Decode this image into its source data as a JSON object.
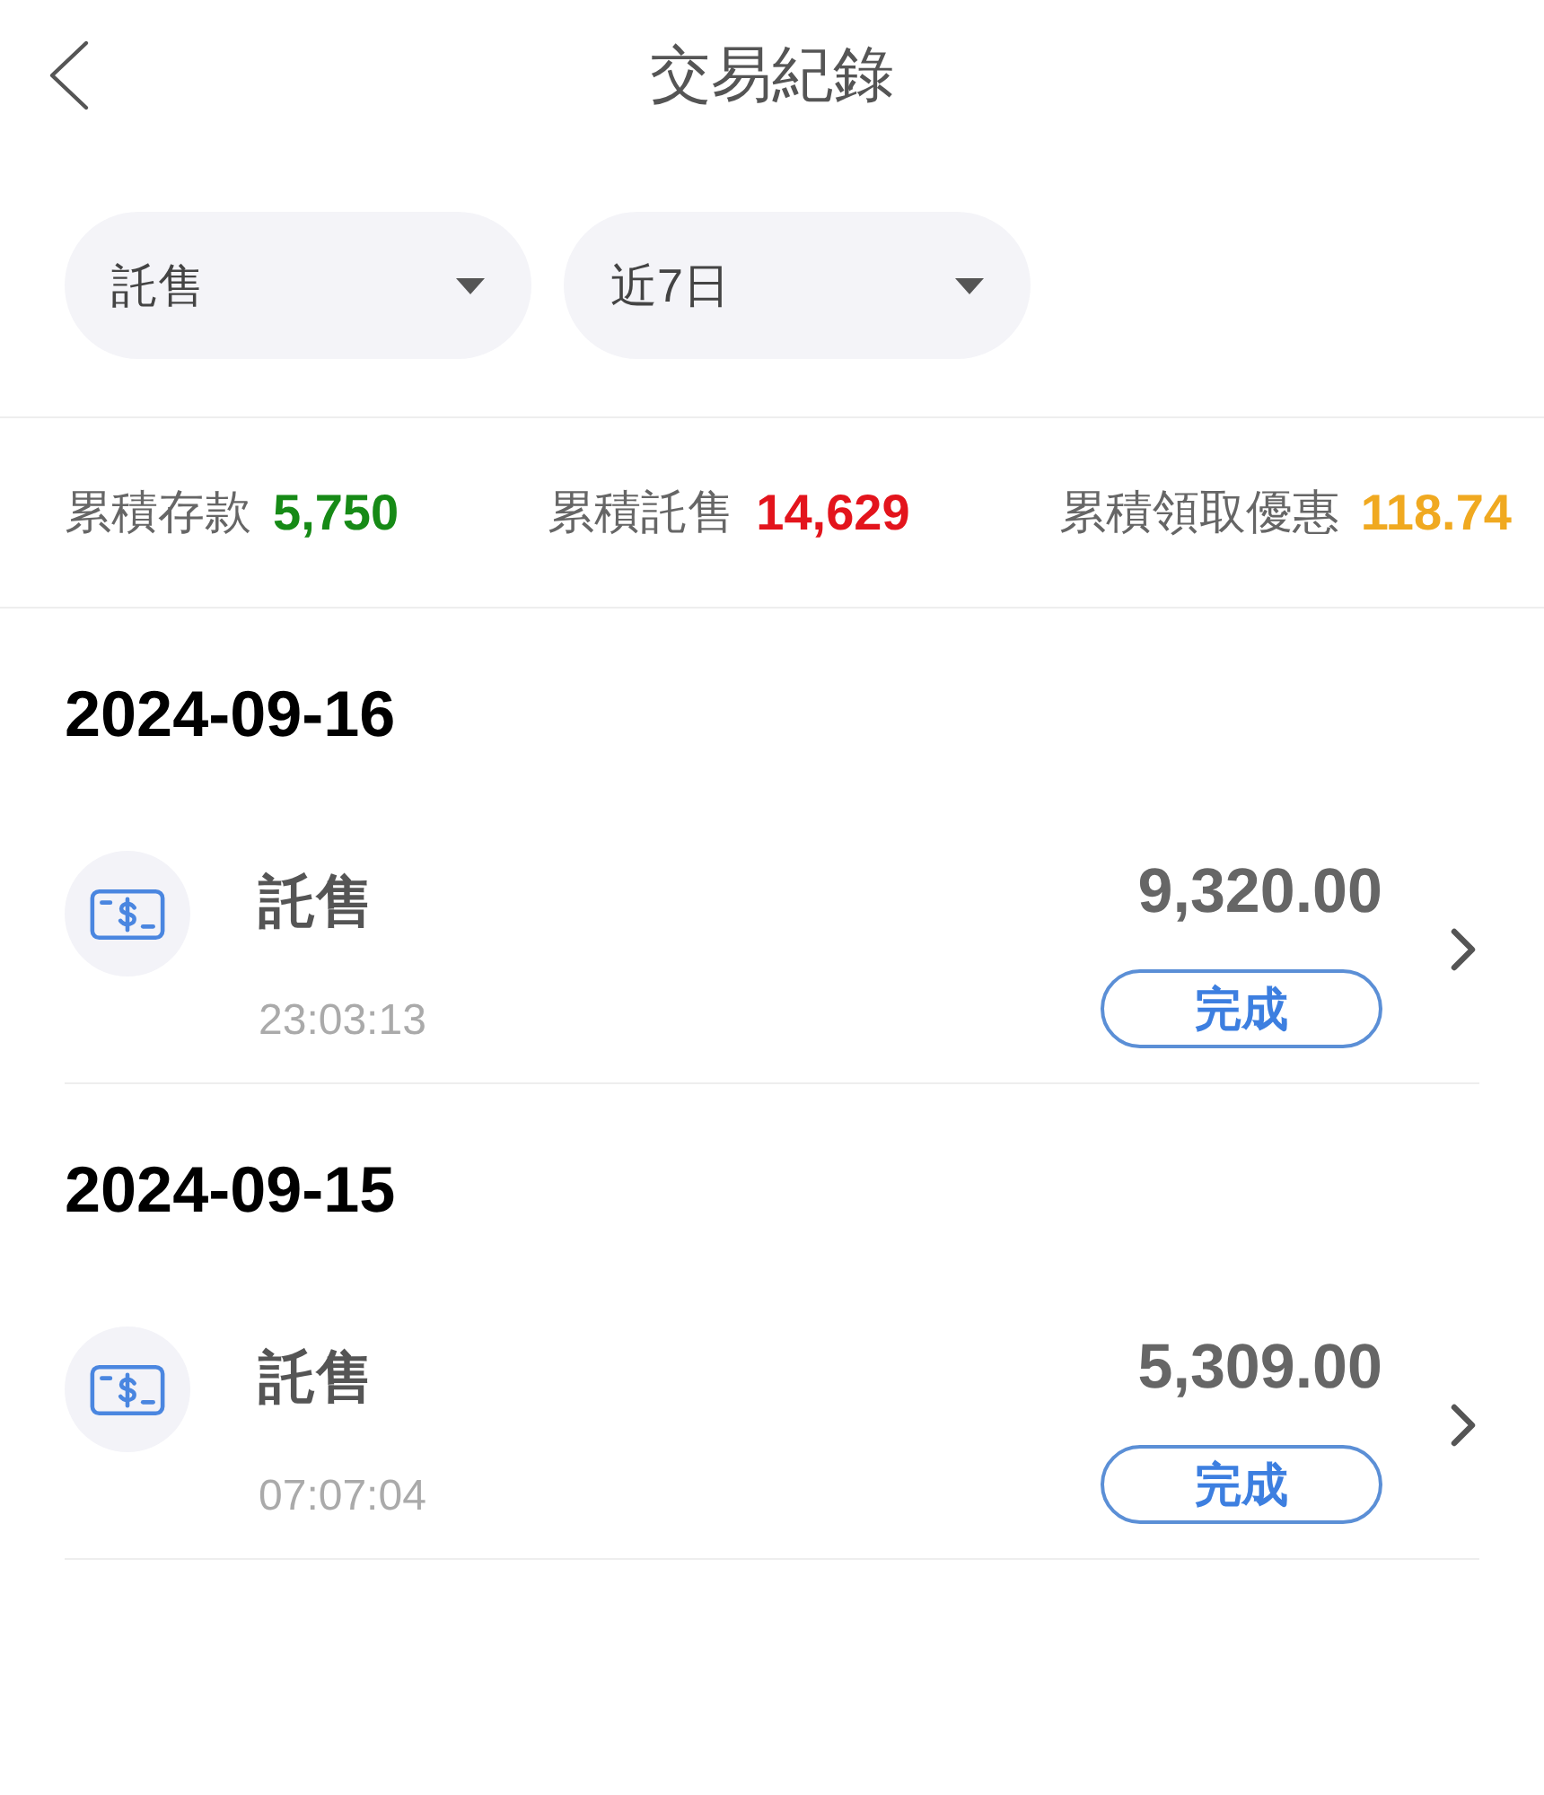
{
  "header": {
    "title": "交易紀錄"
  },
  "filters": [
    {
      "label": "託售"
    },
    {
      "label": "近7日"
    }
  ],
  "summary": [
    {
      "label": "累積存款",
      "value": "5,750",
      "color": "#168a16"
    },
    {
      "label": "累積託售",
      "value": "14,629",
      "color": "#e3141c"
    },
    {
      "label": "累積領取優惠",
      "value": "118.74",
      "color": "#f0a920"
    }
  ],
  "groups": [
    {
      "date": "2024-09-16",
      "transactions": [
        {
          "type": "託售",
          "time": "23:03:13",
          "amount": "9,320.00",
          "status": "完成"
        }
      ]
    },
    {
      "date": "2024-09-15",
      "transactions": [
        {
          "type": "託售",
          "time": "07:07:04",
          "amount": "5,309.00",
          "status": "完成"
        }
      ]
    }
  ]
}
